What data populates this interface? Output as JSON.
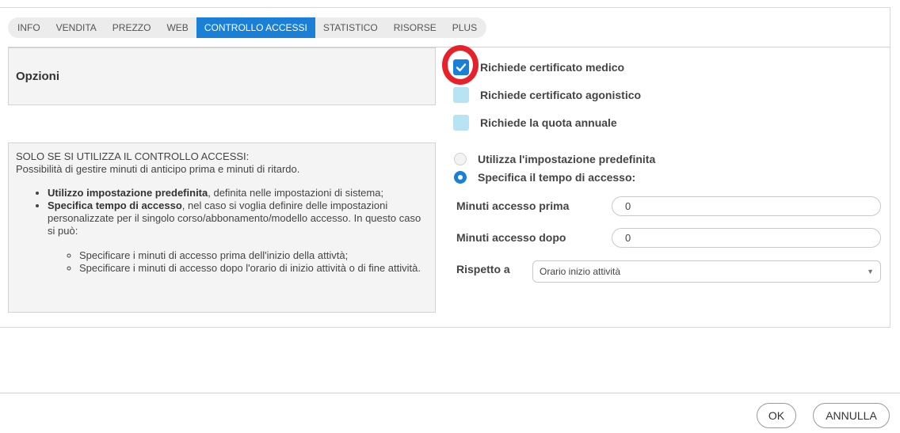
{
  "tabs": [
    {
      "label": "INFO",
      "active": false
    },
    {
      "label": "VENDITA",
      "active": false
    },
    {
      "label": "PREZZO",
      "active": false
    },
    {
      "label": "WEB",
      "active": false
    },
    {
      "label": "CONTROLLO ACCESSI",
      "active": true
    },
    {
      "label": "STATISTICO",
      "active": false
    },
    {
      "label": "RISORSE",
      "active": false
    },
    {
      "label": "PLUS",
      "active": false
    }
  ],
  "options": {
    "title": "Opzioni"
  },
  "checkboxes": [
    {
      "label": "Richiede certificato medico",
      "checked": true
    },
    {
      "label": "Richiede certificato agonistico",
      "checked": false
    },
    {
      "label": "Richiede la quota annuale",
      "checked": false
    }
  ],
  "help": {
    "line1": "SOLO SE SI UTILIZZA IL CONTROLLO ACCESSI:",
    "line2": "Possibilità di gestire minuti di anticipo prima e minuti di ritardo.",
    "item1_bold": "Utilizzo impostazione predefinita",
    "item1_rest": ", definita nelle impostazioni di sistema;",
    "item2_bold": "Specifica tempo di accesso",
    "item2_rest": ", nel caso si voglia definire delle impostazioni personalizzate per il singolo corso/abbonamento/modello accesso. In questo caso si può:",
    "sub1": "Specificare i minuti di accesso prima dell'inizio della attivtà;",
    "sub2": "Specificare i minuti di accesso dopo l'orario di inizio attività o di fine attività."
  },
  "radios": [
    {
      "label": "Utilizza l'impostazione predefinita",
      "selected": false
    },
    {
      "label": "Specifica il tempo di accesso:",
      "selected": true
    }
  ],
  "fields": {
    "before_label": "Minuti accesso prima",
    "before_value": "0",
    "after_label": "Minuti accesso dopo",
    "after_value": "0",
    "respect_label": "Rispetto a",
    "respect_value": "Orario inizio attività"
  },
  "footer": {
    "ok": "OK",
    "cancel": "ANNULLA"
  },
  "colors": {
    "accent": "#1a7fd6",
    "checkbox_off": "#b8e3f3",
    "highlight": "#e8202a"
  }
}
